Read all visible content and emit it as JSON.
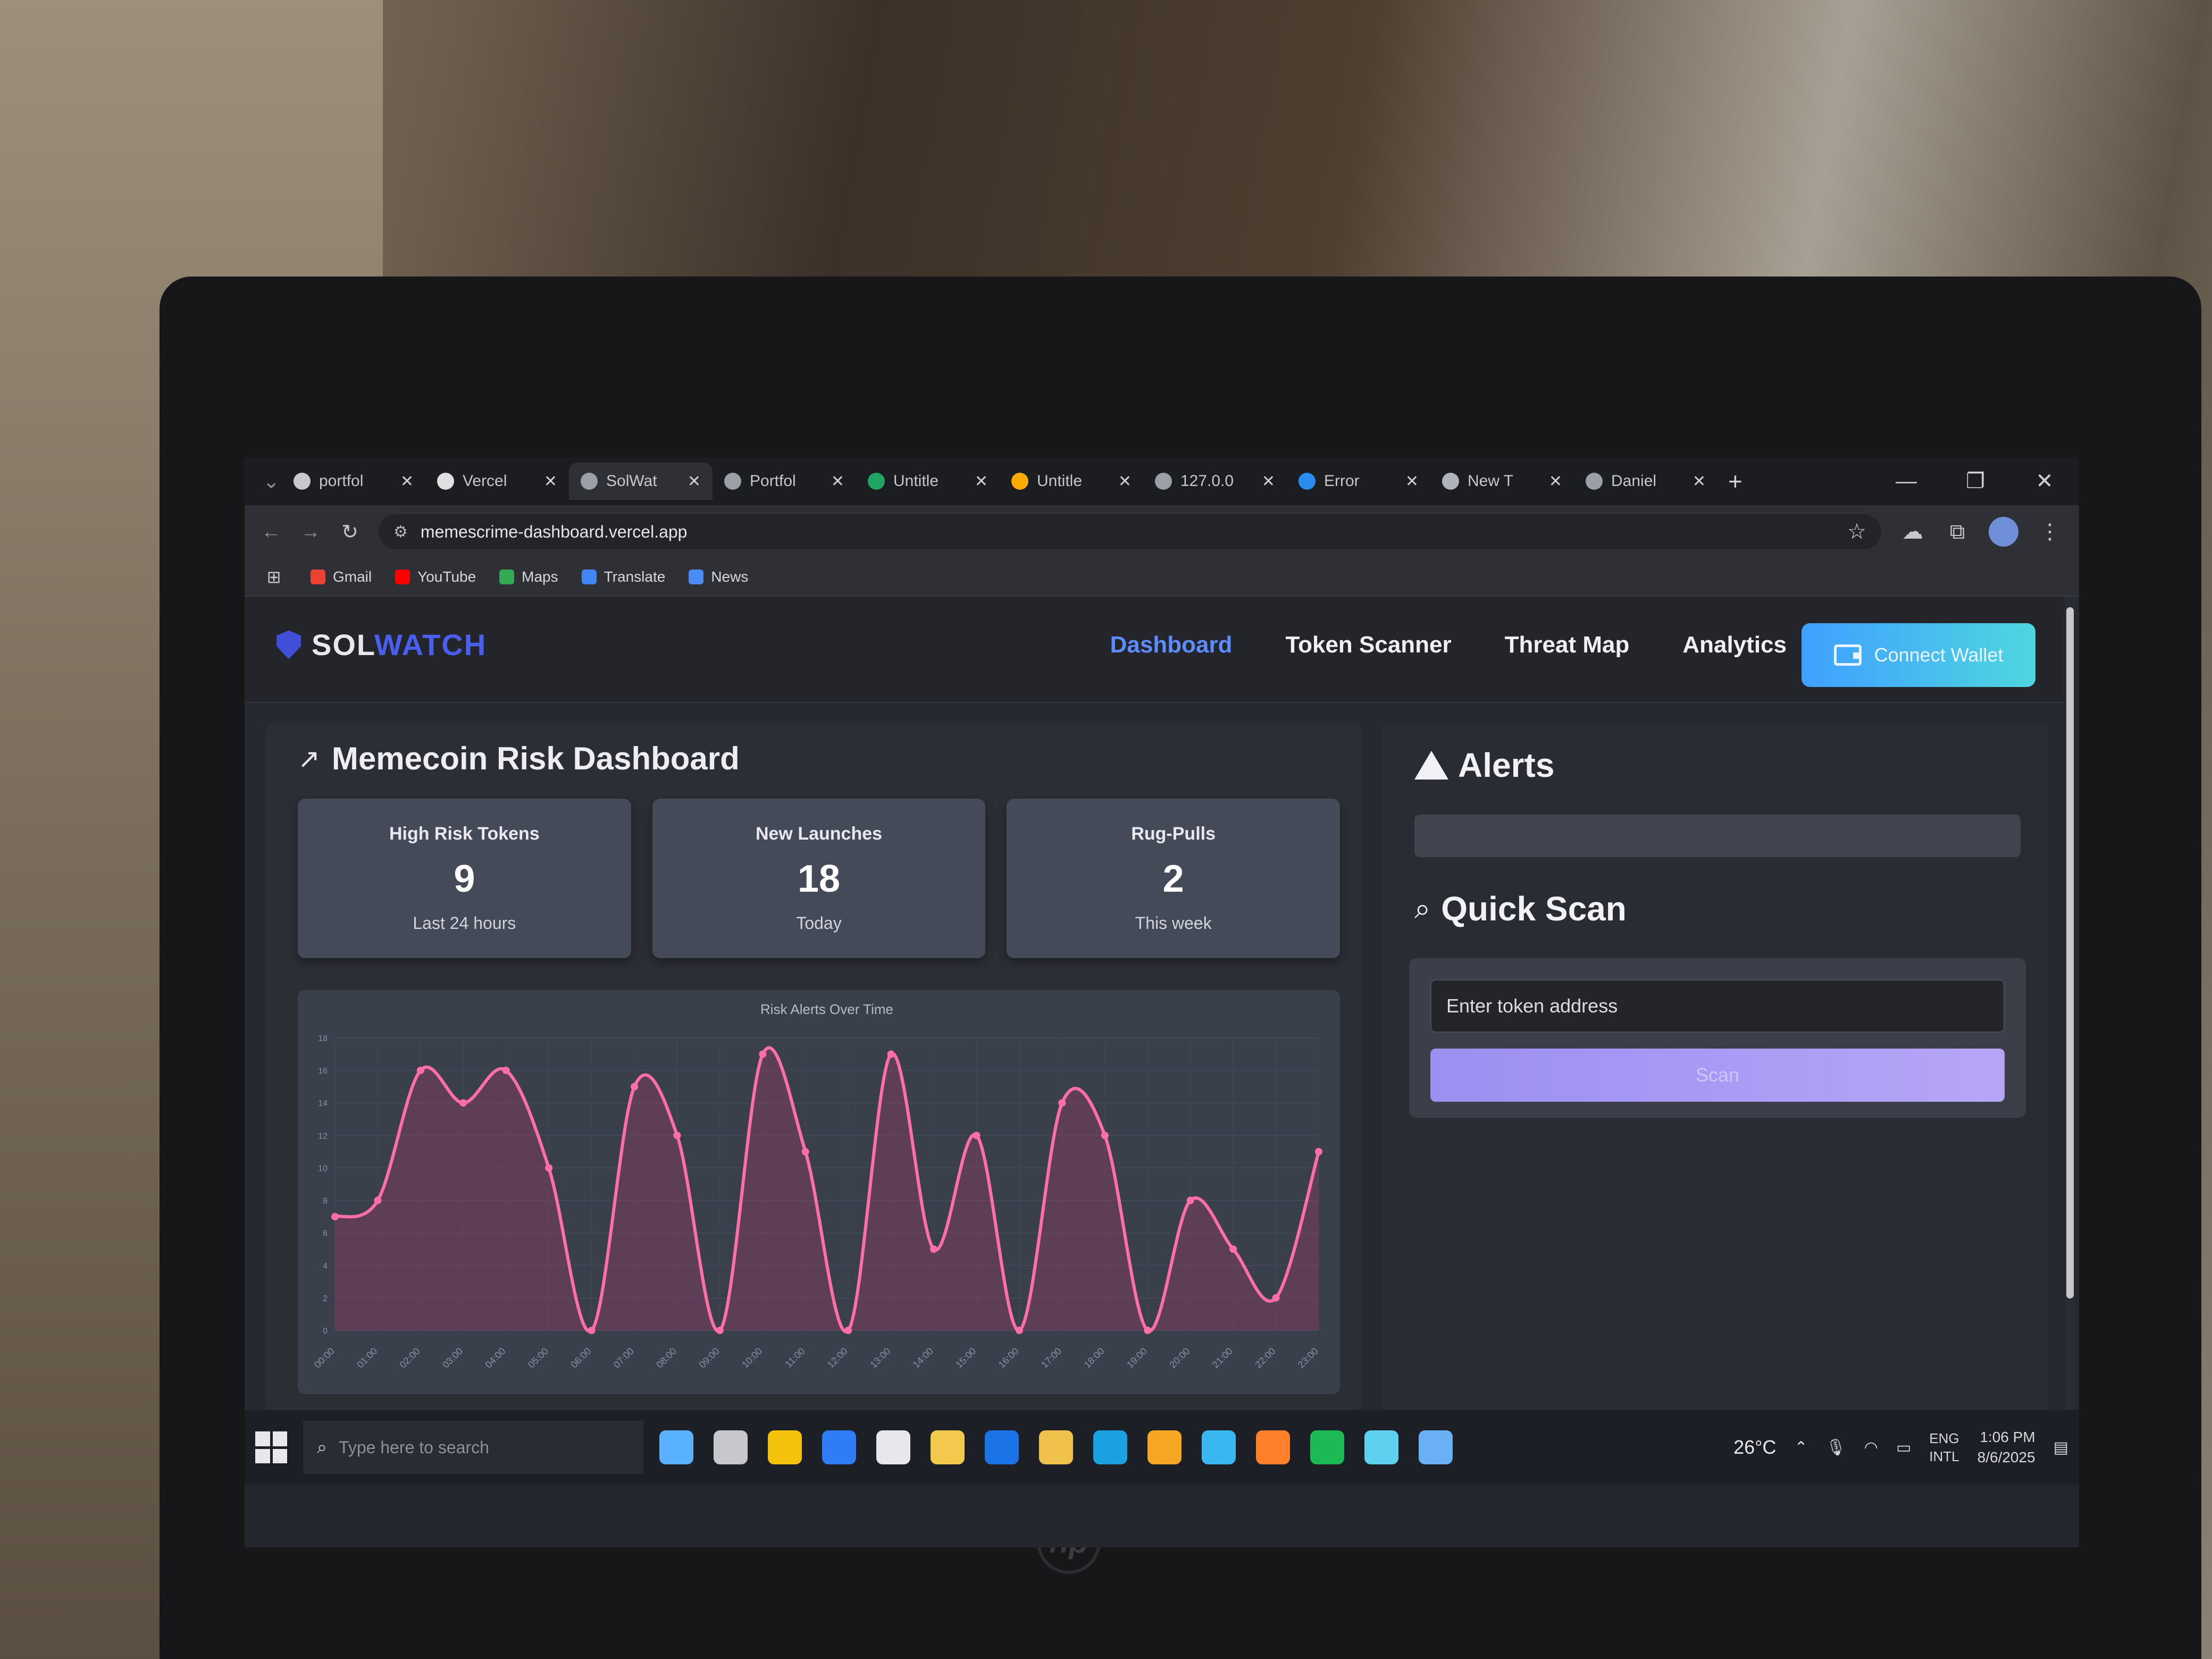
{
  "browser": {
    "tabs": [
      {
        "title": "portfol",
        "icon": "github-icon",
        "color": "#c9c9cc"
      },
      {
        "title": "Vercel",
        "icon": "vercel-icon",
        "color": "#e0e0e0"
      },
      {
        "title": "SolWat",
        "icon": "globe-icon",
        "color": "#9aa0a6",
        "active": true
      },
      {
        "title": "Portfol",
        "icon": "globe-icon",
        "color": "#9aa0a6"
      },
      {
        "title": "Untitle",
        "icon": "sheets-icon",
        "color": "#21a464"
      },
      {
        "title": "Untitle",
        "icon": "colab-icon",
        "color": "#f9ab00"
      },
      {
        "title": "127.0.0",
        "icon": "globe-icon",
        "color": "#9aa0a6"
      },
      {
        "title": "Error",
        "icon": "arrow-icon",
        "color": "#2b8cf0"
      },
      {
        "title": "New T",
        "icon": "chrome-icon",
        "color": "#b0b4ba"
      },
      {
        "title": "Daniel",
        "icon": "globe-icon",
        "color": "#9aa0a6"
      }
    ],
    "url": "memescrime-dashboard.vercel.app",
    "bookmarks": [
      {
        "label": "Gmail",
        "color": "#ea4335"
      },
      {
        "label": "YouTube",
        "color": "#ff0000"
      },
      {
        "label": "Maps",
        "color": "#34a853"
      },
      {
        "label": "Translate",
        "color": "#4285f4"
      },
      {
        "label": "News",
        "color": "#4a8bf5"
      }
    ]
  },
  "app": {
    "brand_prefix": "SOL",
    "brand_suffix": "WATCH",
    "nav": [
      "Dashboard",
      "Token Scanner",
      "Threat Map",
      "Analytics"
    ],
    "active_nav": "Dashboard",
    "connect_label": "Connect Wallet",
    "dashboard_title": "Memecoin Risk Dashboard",
    "stats": [
      {
        "label": "High Risk Tokens",
        "value": "9",
        "sub": "Last 24 hours"
      },
      {
        "label": "New Launches",
        "value": "18",
        "sub": "Today"
      },
      {
        "label": "Rug-Pulls",
        "value": "2",
        "sub": "This week"
      }
    ],
    "alerts_title": "Alerts",
    "quick_scan_title": "Quick Scan",
    "token_placeholder": "Enter token address",
    "scan_label": "Scan"
  },
  "chart_data": {
    "type": "line",
    "title": "Risk Alerts Over Time",
    "categories": [
      "00:00",
      "01:00",
      "02:00",
      "03:00",
      "04:00",
      "05:00",
      "06:00",
      "07:00",
      "08:00",
      "09:00",
      "10:00",
      "11:00",
      "12:00",
      "13:00",
      "14:00",
      "15:00",
      "16:00",
      "17:00",
      "18:00",
      "19:00",
      "20:00",
      "21:00",
      "22:00",
      "23:00"
    ],
    "values": [
      7,
      8,
      16,
      14,
      16,
      10,
      0,
      15,
      12,
      0,
      17,
      11,
      0,
      17,
      5,
      12,
      0,
      14,
      12,
      0,
      8,
      5,
      2,
      11
    ],
    "yticks": [
      0,
      2,
      4,
      6,
      8,
      10,
      12,
      14,
      16,
      18
    ],
    "ylim": [
      0,
      18
    ],
    "line_color": "#ff6fa6",
    "fill_color": "#a23d6c",
    "grid": true
  },
  "taskbar": {
    "search_placeholder": "Type here to search",
    "apps": [
      "#5ab1ff",
      "#c8c8cc",
      "#f4c20d",
      "#2f7cf6",
      "#e8e8ec",
      "#f2c94c",
      "#1b73e8",
      "#f0c24b",
      "#1ba1e2",
      "#f5a623",
      "#3ab7f0",
      "#ff7f2a",
      "#1db954",
      "#5fd1f0",
      "#6ab0f5"
    ],
    "temperature": "26°C",
    "lang_top": "ENG",
    "lang_bottom": "INTL",
    "time": "1:06 PM",
    "date": "8/6/2025"
  }
}
